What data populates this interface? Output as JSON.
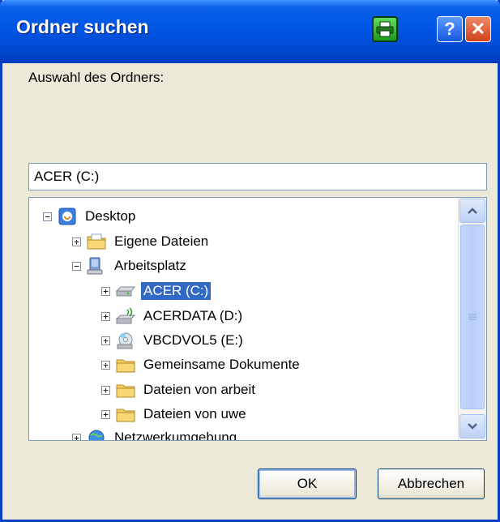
{
  "window": {
    "title": "Ordner suchen",
    "titlebar_color": "#0055e5"
  },
  "titlebar_buttons": {
    "help_label": "?",
    "close_label": "✕"
  },
  "instructions": "Auswahl des Ordners:",
  "path_value": "ACER (C:)",
  "tree": {
    "items": [
      {
        "label": "Desktop",
        "expander": "−",
        "icon": "desktop-icon"
      },
      {
        "label": "Eigene Dateien",
        "expander": "+",
        "icon": "documents-folder-icon"
      },
      {
        "label": "Arbeitsplatz",
        "expander": "−",
        "icon": "computer-icon"
      },
      {
        "label": "ACER (C:)",
        "expander": "+",
        "icon": "hard-drive-icon",
        "selected": true
      },
      {
        "label": "ACERDATA (D:)",
        "expander": "+",
        "icon": "removable-drive-icon"
      },
      {
        "label": "VBCDVOL5 (E:)",
        "expander": "+",
        "icon": "cd-drive-icon"
      },
      {
        "label": "Gemeinsame Dokumente",
        "expander": "+",
        "icon": "folder-icon"
      },
      {
        "label": "Dateien von arbeit",
        "expander": "+",
        "icon": "folder-icon"
      },
      {
        "label": "Dateien von uwe",
        "expander": "+",
        "icon": "folder-icon"
      },
      {
        "label": "Netzwerkumgebung",
        "expander": "+",
        "icon": "network-icon"
      }
    ],
    "selection_color": "#316ac5"
  },
  "buttons": {
    "ok_label": "OK",
    "cancel_label": "Abbrechen"
  }
}
